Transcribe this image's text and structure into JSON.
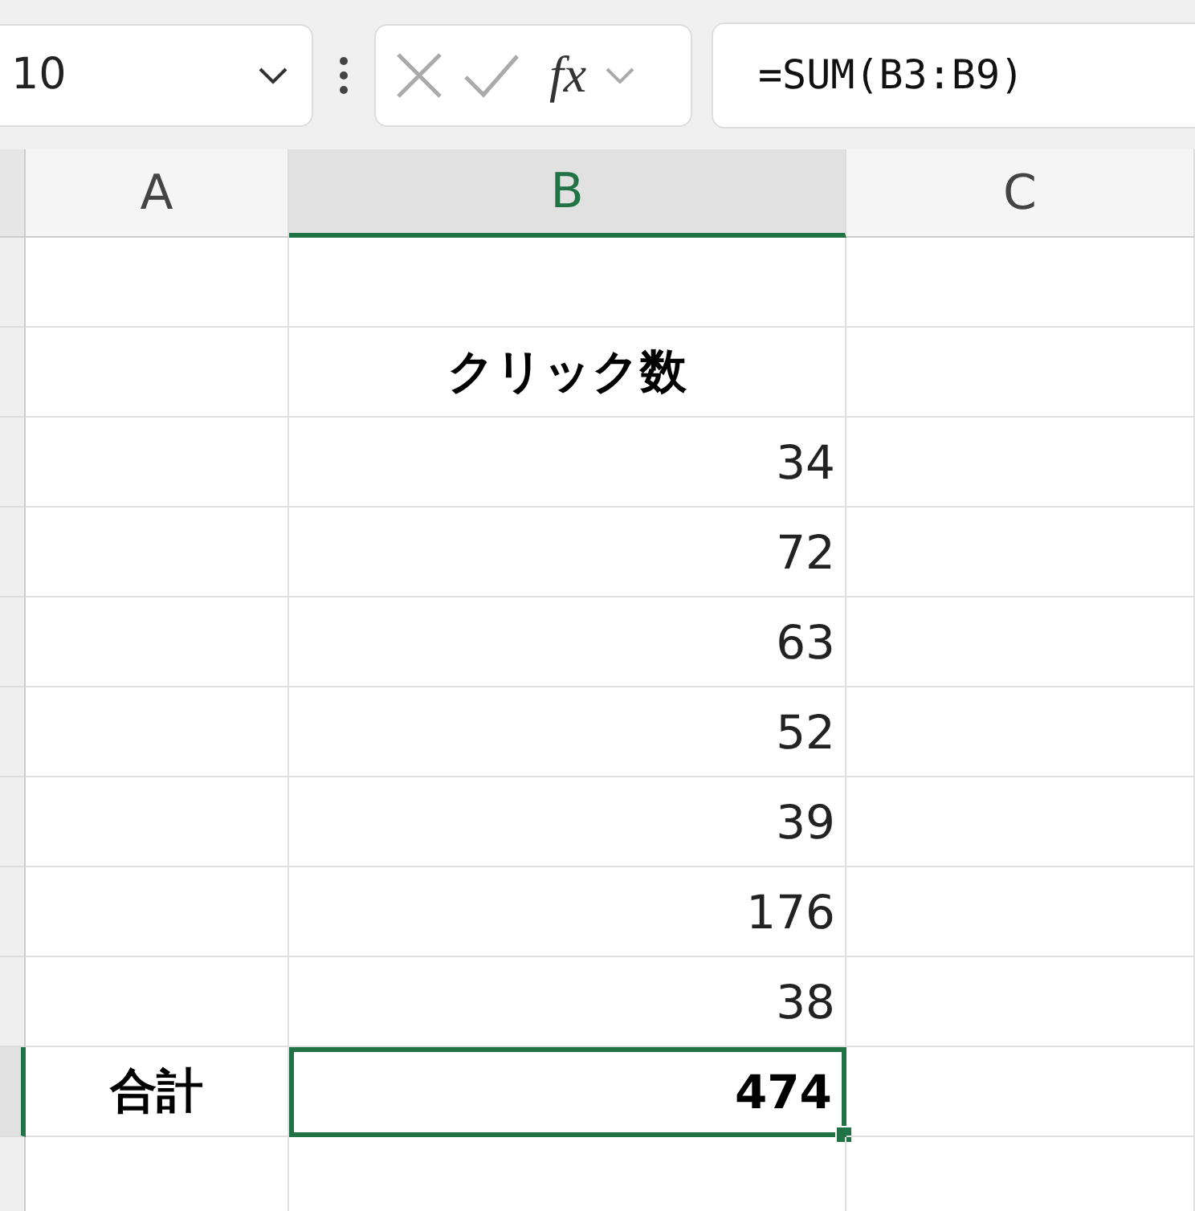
{
  "name_box": {
    "value": "10"
  },
  "formula_bar": {
    "function_label": "fx",
    "formula": "=SUM(B3:B9)"
  },
  "columns": [
    {
      "label": "A",
      "selected": false
    },
    {
      "label": "B",
      "selected": true
    },
    {
      "label": "C",
      "selected": false
    }
  ],
  "rows": [
    {
      "selected": false
    },
    {
      "selected": false,
      "cells": [
        null,
        {
          "text": "クリック数",
          "bold": true,
          "kind": "text",
          "selected": false
        }
      ]
    },
    {
      "selected": false,
      "cells": [
        null,
        {
          "text": "34",
          "bold": false,
          "kind": "number",
          "selected": false
        }
      ]
    },
    {
      "selected": false,
      "cells": [
        null,
        {
          "text": "72",
          "bold": false,
          "kind": "number",
          "selected": false
        }
      ]
    },
    {
      "selected": false,
      "cells": [
        null,
        {
          "text": "63",
          "bold": false,
          "kind": "number",
          "selected": false
        }
      ]
    },
    {
      "selected": false,
      "cells": [
        null,
        {
          "text": "52",
          "bold": false,
          "kind": "number",
          "selected": false
        }
      ]
    },
    {
      "selected": false,
      "cells": [
        null,
        {
          "text": "39",
          "bold": false,
          "kind": "number",
          "selected": false
        }
      ]
    },
    {
      "selected": false,
      "cells": [
        null,
        {
          "text": "176",
          "bold": false,
          "kind": "number",
          "selected": false
        }
      ]
    },
    {
      "selected": false,
      "cells": [
        null,
        {
          "text": "38",
          "bold": false,
          "kind": "number",
          "selected": false
        }
      ]
    },
    {
      "selected": true,
      "cells": [
        {
          "text": "合計",
          "bold": true,
          "kind": "text",
          "selected": false
        },
        {
          "text": "474",
          "bold": true,
          "kind": "number",
          "selected": true
        }
      ]
    },
    {
      "selected": false
    }
  ]
}
